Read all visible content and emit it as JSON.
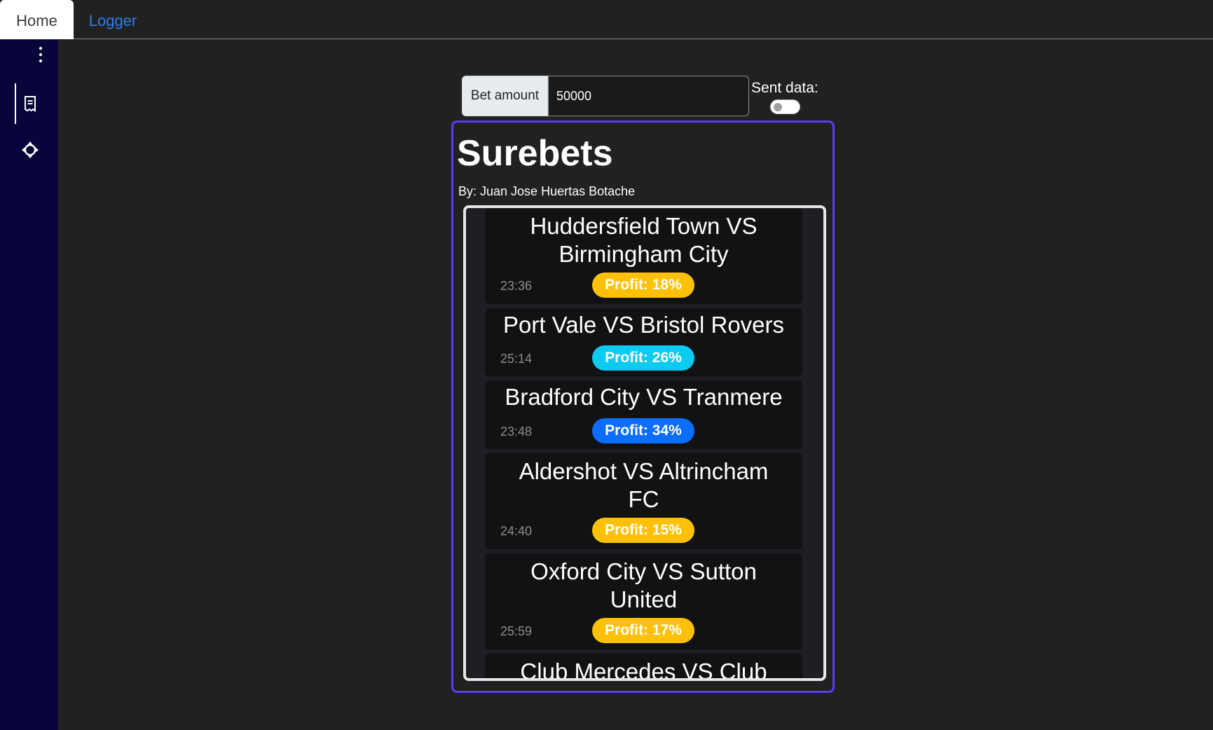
{
  "tabs": [
    {
      "label": "Home",
      "active": true
    },
    {
      "label": "Logger",
      "active": false
    }
  ],
  "sidebar": {
    "icons": [
      "more-vertical-icon",
      "receipt-icon",
      "move-arrows-icon"
    ]
  },
  "bet": {
    "label": "Bet amount",
    "value": "50000"
  },
  "sent": {
    "label": "Sent data:",
    "enabled": false
  },
  "panel": {
    "title": "Surebets",
    "author": "By: Juan Jose Huertas Botache"
  },
  "colors": {
    "accent_border": "#5b3df5",
    "sidebar_bg": "#07053a",
    "badge_warning": "#ffc107",
    "badge_info": "#0dcaf0",
    "badge_primary": "#0d6efd"
  },
  "matches": [
    {
      "title_line1": "Huddersfield Town VS",
      "title_line2": "Birmingham City",
      "time": "23:36",
      "profit": "Profit: 18%",
      "badge_color": "#ffc107"
    },
    {
      "title_line1": "Port Vale VS Bristol Rovers",
      "title_line2": "",
      "time": "25:14",
      "profit": "Profit: 26%",
      "badge_color": "#0dcaf0"
    },
    {
      "title_line1": "Bradford City VS Tranmere",
      "title_line2": "",
      "time": "23:48",
      "profit": "Profit: 34%",
      "badge_color": "#0d6efd"
    },
    {
      "title_line1": "Aldershot VS Altrincham",
      "title_line2": "FC",
      "time": "24:40",
      "profit": "Profit: 15%",
      "badge_color": "#ffc107"
    },
    {
      "title_line1": "Oxford City VS Sutton",
      "title_line2": "United",
      "time": "25:59",
      "profit": "Profit: 17%",
      "badge_color": "#ffc107"
    },
    {
      "title_line1": "Club Mercedes VS Club",
      "title_line2": "",
      "time": "",
      "profit": "",
      "badge_color": ""
    }
  ]
}
